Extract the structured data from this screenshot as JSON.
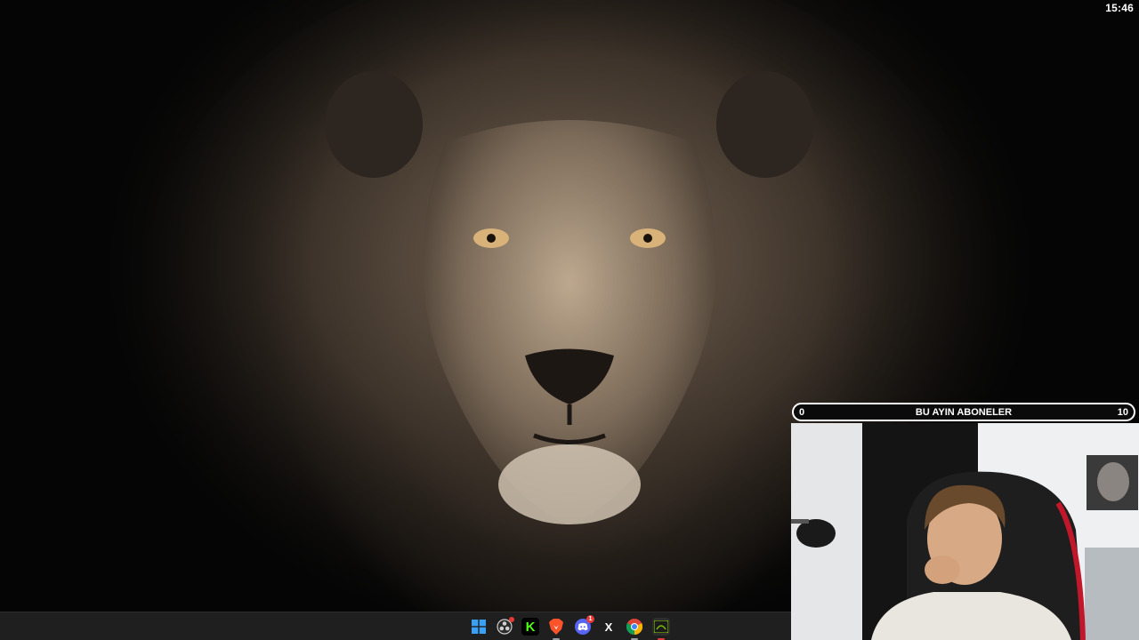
{
  "clock": {
    "time": "15:46"
  },
  "subscriber_goal": {
    "title": "BU AYIN ABONELER",
    "min": "0",
    "max": "10",
    "current_fraction": 0
  },
  "taskbar": {
    "icons": [
      {
        "name": "windows-start-icon",
        "label": ""
      },
      {
        "name": "obs-icon",
        "label": ""
      },
      {
        "name": "kick-icon",
        "label": "K"
      },
      {
        "name": "brave-browser-icon",
        "label": ""
      },
      {
        "name": "discord-icon",
        "label": "",
        "badge": "1"
      },
      {
        "name": "x-twitter-icon",
        "label": "X"
      },
      {
        "name": "chrome-icon",
        "label": ""
      },
      {
        "name": "nvidia-app-icon",
        "label": ""
      }
    ]
  },
  "colors": {
    "taskbar_bg": "#1f1f1f",
    "goal_border": "#ffffff",
    "goal_bg": "#0b0b0b",
    "kick_green": "#53fc18",
    "brave_orange": "#fb542b",
    "discord_blurple": "#5865f2",
    "windows_blue": "#3aa0f3"
  }
}
